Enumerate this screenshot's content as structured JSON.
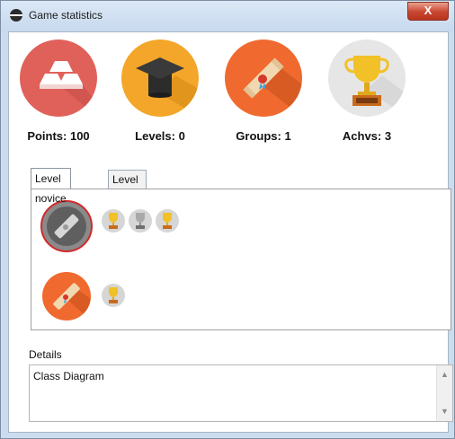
{
  "window": {
    "title": "Game statistics",
    "close_label": "X",
    "icon": "app-icon"
  },
  "stats": [
    {
      "label": "Points: 100",
      "icon": "gold-bars-icon",
      "color": "#e0615a"
    },
    {
      "label": "Levels: 0",
      "icon": "graduation-cap-icon",
      "color": "#f3a629"
    },
    {
      "label": "Groups: 1",
      "icon": "diploma-icon",
      "color": "#f0692e"
    },
    {
      "label": "Achvs: 3",
      "icon": "trophy-icon",
      "color": "#e6e6e6"
    }
  ],
  "tabs": [
    {
      "label": "Level novice",
      "active": true
    },
    {
      "label": "Level expert",
      "active": false
    }
  ],
  "level_novice": {
    "rows": [
      {
        "group_icon": "diploma-icon",
        "group_state": "selected-grey",
        "achievements": [
          "trophy-gold-icon",
          "trophy-grey-icon",
          "trophy-gold-icon"
        ]
      },
      {
        "group_icon": "diploma-icon",
        "group_state": "orange",
        "achievements": [
          "trophy-gold-icon"
        ]
      }
    ]
  },
  "details": {
    "label": "Details",
    "text": "Class Diagram"
  },
  "icons": {
    "scroll_up": "scroll-up-arrow-icon",
    "scroll_down": "scroll-down-arrow-icon"
  }
}
